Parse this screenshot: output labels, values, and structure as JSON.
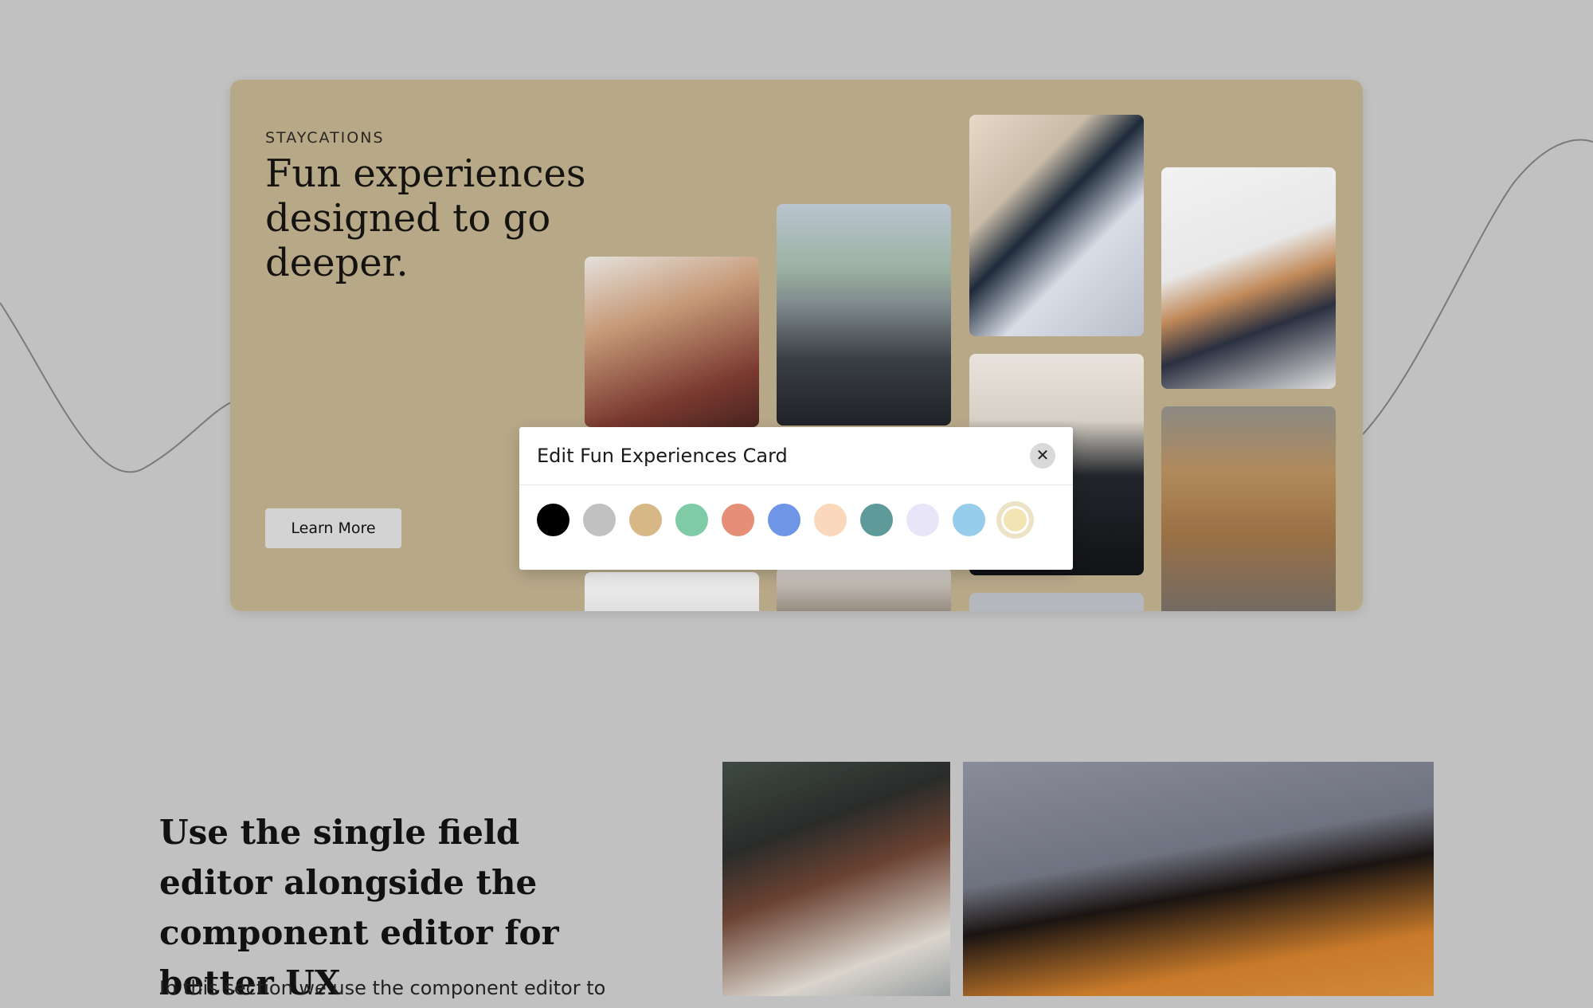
{
  "hero_card": {
    "eyebrow": "STAYCATIONS",
    "headline": "Fun experiences designed to go deeper.",
    "cta_label": "Learn More",
    "background_color": "#b7a888"
  },
  "modal": {
    "title": "Edit Fun Experiences Card",
    "close_icon": "close-icon",
    "swatches": [
      {
        "color": "#000000"
      },
      {
        "color": "#c1c1c1"
      },
      {
        "color": "#d8b787"
      },
      {
        "color": "#7ecba5"
      },
      {
        "color": "#e48f76"
      },
      {
        "color": "#6f95e6"
      },
      {
        "color": "#fbd8bb"
      },
      {
        "color": "#5f9a9a"
      },
      {
        "color": "#e7e5f7"
      },
      {
        "color": "#97cceb"
      },
      {
        "color": "#f3e4b3",
        "selected": true
      }
    ]
  },
  "section": {
    "title": "Use the single field editor alongside the component editor for better UX",
    "body": "In this section we use the component editor to"
  }
}
